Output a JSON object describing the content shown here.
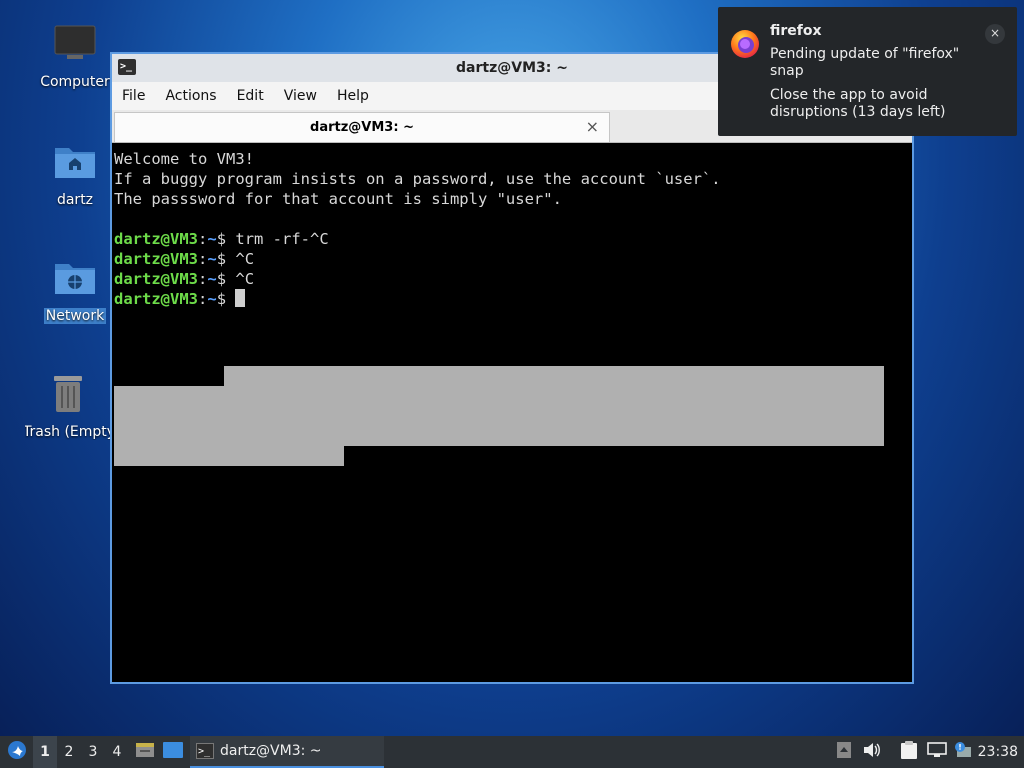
{
  "desktop": {
    "icons": [
      {
        "label": "Computer",
        "icon": "computer-icon"
      },
      {
        "label": "dartz",
        "icon": "home-folder-icon"
      },
      {
        "label": "Network",
        "icon": "network-folder-icon"
      },
      {
        "label": "Trash (Empty)",
        "icon": "trash-icon"
      }
    ]
  },
  "window": {
    "title": "dartz@VM3: ~",
    "menu": [
      "File",
      "Actions",
      "Edit",
      "View",
      "Help"
    ],
    "tab_label": "dartz@VM3: ~",
    "terminal": {
      "welcome": [
        "Welcome to VM3!",
        "If a buggy program insists on a password, use the account `user`.",
        "The passsword for that account is simply \"user\"."
      ],
      "prompt_user": "dartz@VM3",
      "prompt_sep": ":",
      "prompt_path": "~",
      "prompt_end": "$ ",
      "commands": [
        "trm -rf-^C",
        "^C",
        "^C",
        ""
      ]
    }
  },
  "notification": {
    "app": "firefox",
    "body1": "Pending update of \"firefox\" snap",
    "body2": "Close the app to avoid disruptions (13 days left)",
    "close": "×"
  },
  "taskbar": {
    "workspaces": [
      "1",
      "2",
      "3",
      "4"
    ],
    "active_workspace": "1",
    "task_label": "dartz@VM3: ~",
    "clock": "23:38"
  },
  "colors": {
    "prompt_user": "#6edc4a",
    "prompt_path": "#5aa0ff",
    "window_border": "#5d9be2"
  }
}
